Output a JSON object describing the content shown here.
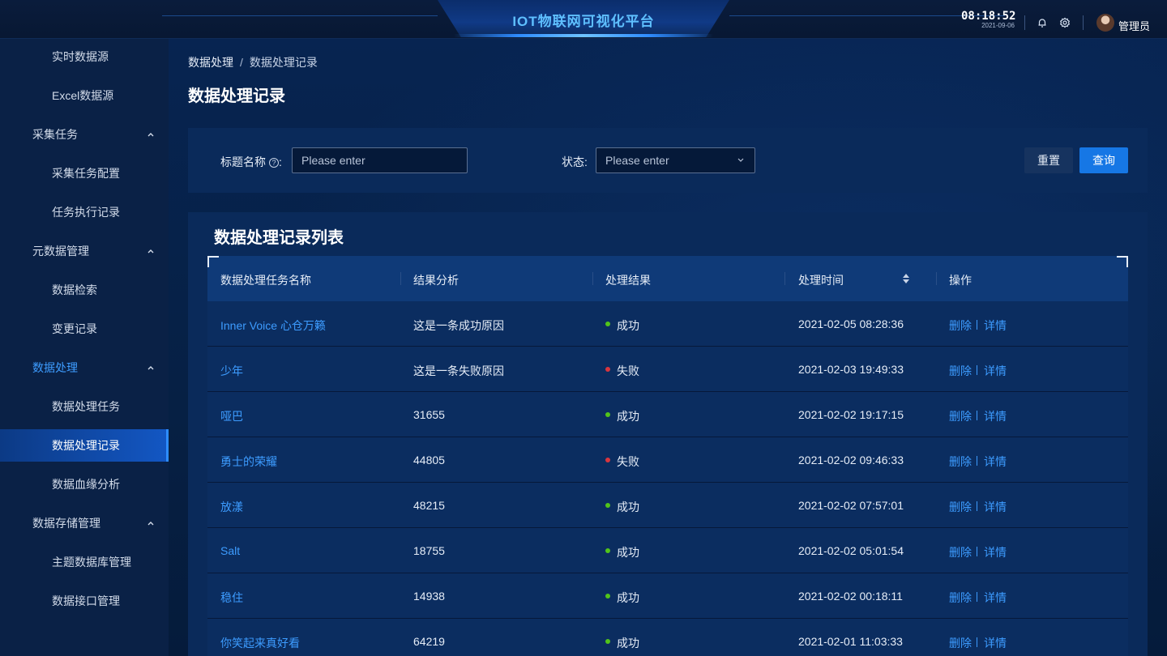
{
  "header": {
    "app_title": "IOT物联网可视化平台",
    "time": "08:18:52",
    "date": "2021-09-06",
    "user_name": "管理员"
  },
  "sidebar": {
    "items": [
      {
        "label": "实时数据源",
        "level": "sub"
      },
      {
        "label": "Excel数据源",
        "level": "sub"
      },
      {
        "label": "采集任务",
        "level": "group"
      },
      {
        "label": "采集任务配置",
        "level": "sub"
      },
      {
        "label": "任务执行记录",
        "level": "sub"
      },
      {
        "label": "元数据管理",
        "level": "group"
      },
      {
        "label": "数据检索",
        "level": "sub"
      },
      {
        "label": "变更记录",
        "level": "sub"
      },
      {
        "label": "数据处理",
        "level": "group",
        "active": true
      },
      {
        "label": "数据处理任务",
        "level": "sub"
      },
      {
        "label": "数据处理记录",
        "level": "sub",
        "selected": true
      },
      {
        "label": "数据血缘分析",
        "level": "sub"
      },
      {
        "label": "数据存储管理",
        "level": "group"
      },
      {
        "label": "主题数据库管理",
        "level": "sub"
      },
      {
        "label": "数据接口管理",
        "level": "sub"
      }
    ]
  },
  "breadcrumb": {
    "parent": "数据处理",
    "separator": "/",
    "current": "数据处理记录"
  },
  "page_title": "数据处理记录",
  "filter": {
    "title_label": "标题名称",
    "title_placeholder": "Please enter",
    "status_label": "状态",
    "status_placeholder": "Please enter",
    "colon": ":",
    "reset_label": "重置",
    "query_label": "查询"
  },
  "table": {
    "title": "数据处理记录列表",
    "columns": [
      "数据处理任务名称",
      "结果分析",
      "处理结果",
      "处理时间",
      "操作"
    ],
    "delete_label": "删除",
    "detail_label": "详情",
    "rows": [
      {
        "name": "Inner Voice 心仓万籁",
        "analysis": "这是一条成功原因",
        "result": "成功",
        "status": "success",
        "time": "2021-02-05 08:28:36"
      },
      {
        "name": "少年",
        "analysis": "这是一条失败原因",
        "result": "失败",
        "status": "fail",
        "time": "2021-02-03 19:49:33"
      },
      {
        "name": "哑巴",
        "analysis": "31655",
        "result": "成功",
        "status": "success",
        "time": "2021-02-02 19:17:15"
      },
      {
        "name": "勇士的荣耀",
        "analysis": "44805",
        "result": "失败",
        "status": "fail",
        "time": "2021-02-02 09:46:33"
      },
      {
        "name": "放漾",
        "analysis": "48215",
        "result": "成功",
        "status": "success",
        "time": "2021-02-02 07:57:01"
      },
      {
        "name": "Salt",
        "analysis": "18755",
        "result": "成功",
        "status": "success",
        "time": "2021-02-02 05:01:54"
      },
      {
        "name": "稳住",
        "analysis": "14938",
        "result": "成功",
        "status": "success",
        "time": "2021-02-02 00:18:11"
      },
      {
        "name": "你笑起来真好看",
        "analysis": "64219",
        "result": "成功",
        "status": "success",
        "time": "2021-02-01 11:03:33"
      }
    ]
  },
  "colors": {
    "accent": "#3d9cff",
    "primary_button": "#1677e5",
    "success": "#52c41a",
    "fail": "#d9363e"
  }
}
